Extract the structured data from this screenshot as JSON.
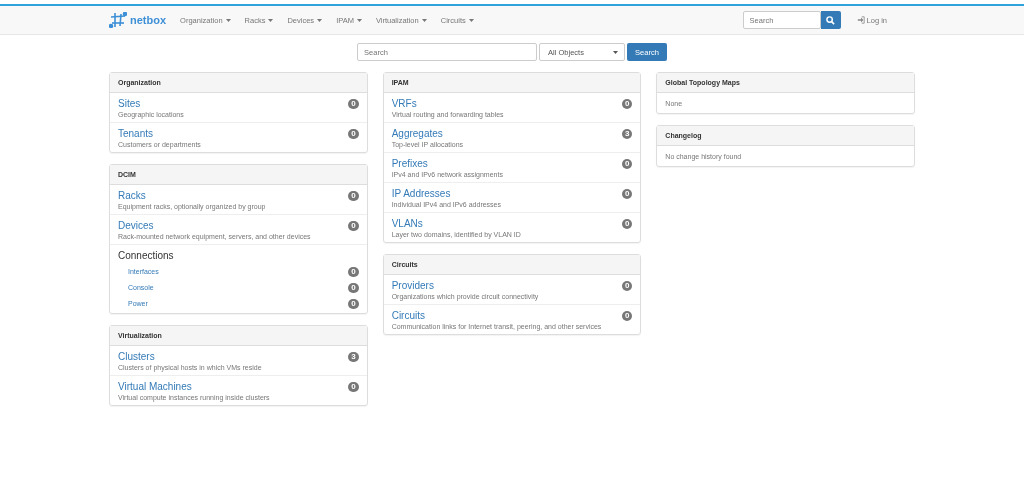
{
  "navbar": {
    "brand": "netbox",
    "menus": [
      "Organization",
      "Racks",
      "Devices",
      "IPAM",
      "Virtualization",
      "Circuits"
    ],
    "search": {
      "placeholder": "Search"
    },
    "login": "Log in"
  },
  "search_bar": {
    "placeholder": "Search",
    "scope": "All Objects",
    "button": "Search"
  },
  "columns": [
    [
      {
        "title": "Organization",
        "items": [
          {
            "kind": "item",
            "title": "Sites",
            "description": "Geographic locations",
            "count": "0"
          },
          {
            "kind": "item",
            "title": "Tenants",
            "description": "Customers or departments",
            "count": "0"
          }
        ]
      },
      {
        "title": "DCIM",
        "items": [
          {
            "kind": "item",
            "title": "Racks",
            "description": "Equipment racks, optionally organized by group",
            "count": "0"
          },
          {
            "kind": "item",
            "title": "Devices",
            "description": "Rack-mounted network equipment, servers, and other devices",
            "count": "0"
          },
          {
            "kind": "group",
            "title": "Connections",
            "children": [
              {
                "label": "Interfaces",
                "count": "0"
              },
              {
                "label": "Console",
                "count": "0"
              },
              {
                "label": "Power",
                "count": "0"
              }
            ]
          }
        ]
      },
      {
        "title": "Virtualization",
        "items": [
          {
            "kind": "item",
            "title": "Clusters",
            "description": "Clusters of physical hosts in which VMs reside",
            "count": "3"
          },
          {
            "kind": "item",
            "title": "Virtual Machines",
            "description": "Virtual compute instances running inside clusters",
            "count": "0"
          }
        ]
      }
    ],
    [
      {
        "title": "IPAM",
        "items": [
          {
            "kind": "item",
            "title": "VRFs",
            "description": "Virtual routing and forwarding tables",
            "count": "0"
          },
          {
            "kind": "item",
            "title": "Aggregates",
            "description": "Top-level IP allocations",
            "count": "3"
          },
          {
            "kind": "item",
            "title": "Prefixes",
            "description": "IPv4 and IPv6 network assignments",
            "count": "0"
          },
          {
            "kind": "item",
            "title": "IP Addresses",
            "description": "Individual IPv4 and IPv6 addresses",
            "count": "0"
          },
          {
            "kind": "item",
            "title": "VLANs",
            "description": "Layer two domains, identified by VLAN ID",
            "count": "0"
          }
        ]
      },
      {
        "title": "Circuits",
        "items": [
          {
            "kind": "item",
            "title": "Providers",
            "description": "Organizations which provide circuit connectivity",
            "count": "0"
          },
          {
            "kind": "item",
            "title": "Circuits",
            "description": "Communication links for Internet transit, peering, and other services",
            "count": "0"
          }
        ]
      }
    ],
    [
      {
        "title": "Global Topology Maps",
        "items": [
          {
            "kind": "text",
            "text": "None"
          }
        ]
      },
      {
        "title": "Changelog",
        "items": [
          {
            "kind": "text",
            "text": "No change history found"
          }
        ]
      }
    ]
  ]
}
